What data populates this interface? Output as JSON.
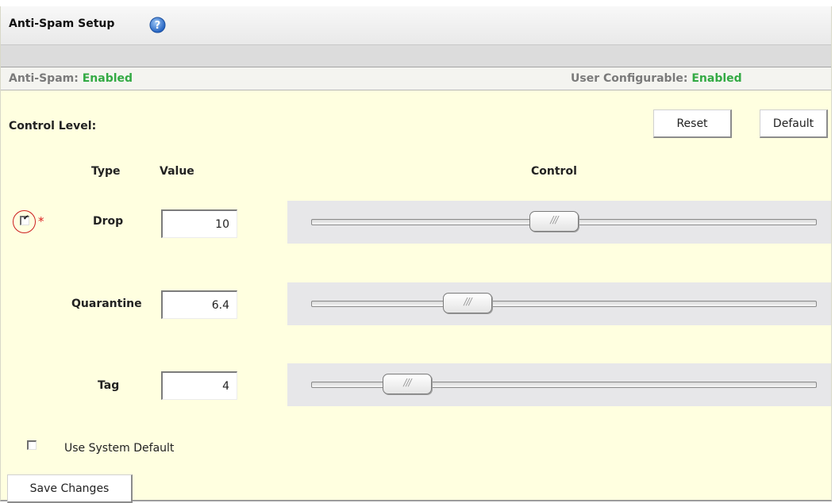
{
  "header": {
    "title": "Anti-Spam Setup",
    "help_icon": "help-icon"
  },
  "status": {
    "anti_spam_label": "Anti-Spam: ",
    "anti_spam_value": "Enabled",
    "user_config_label": "User Configurable: ",
    "user_config_value": "Enabled",
    "enabled_color": "#33aa44"
  },
  "control": {
    "label": "Control Level:",
    "reset_label": "Reset",
    "default_label": "Default"
  },
  "columns": {
    "type": "Type",
    "value": "Value",
    "control": "Control"
  },
  "rows": [
    {
      "type": "Drop",
      "value": "10",
      "slider_level": 0.48,
      "checked": true,
      "required": "*"
    },
    {
      "type": "Quarantine",
      "value": "6.4",
      "slider_level": 0.31
    },
    {
      "type": "Tag",
      "value": "4",
      "slider_level": 0.19
    }
  ],
  "use_system_default": {
    "label": "Use System Default",
    "checked": false
  },
  "save_label": "Save Changes"
}
